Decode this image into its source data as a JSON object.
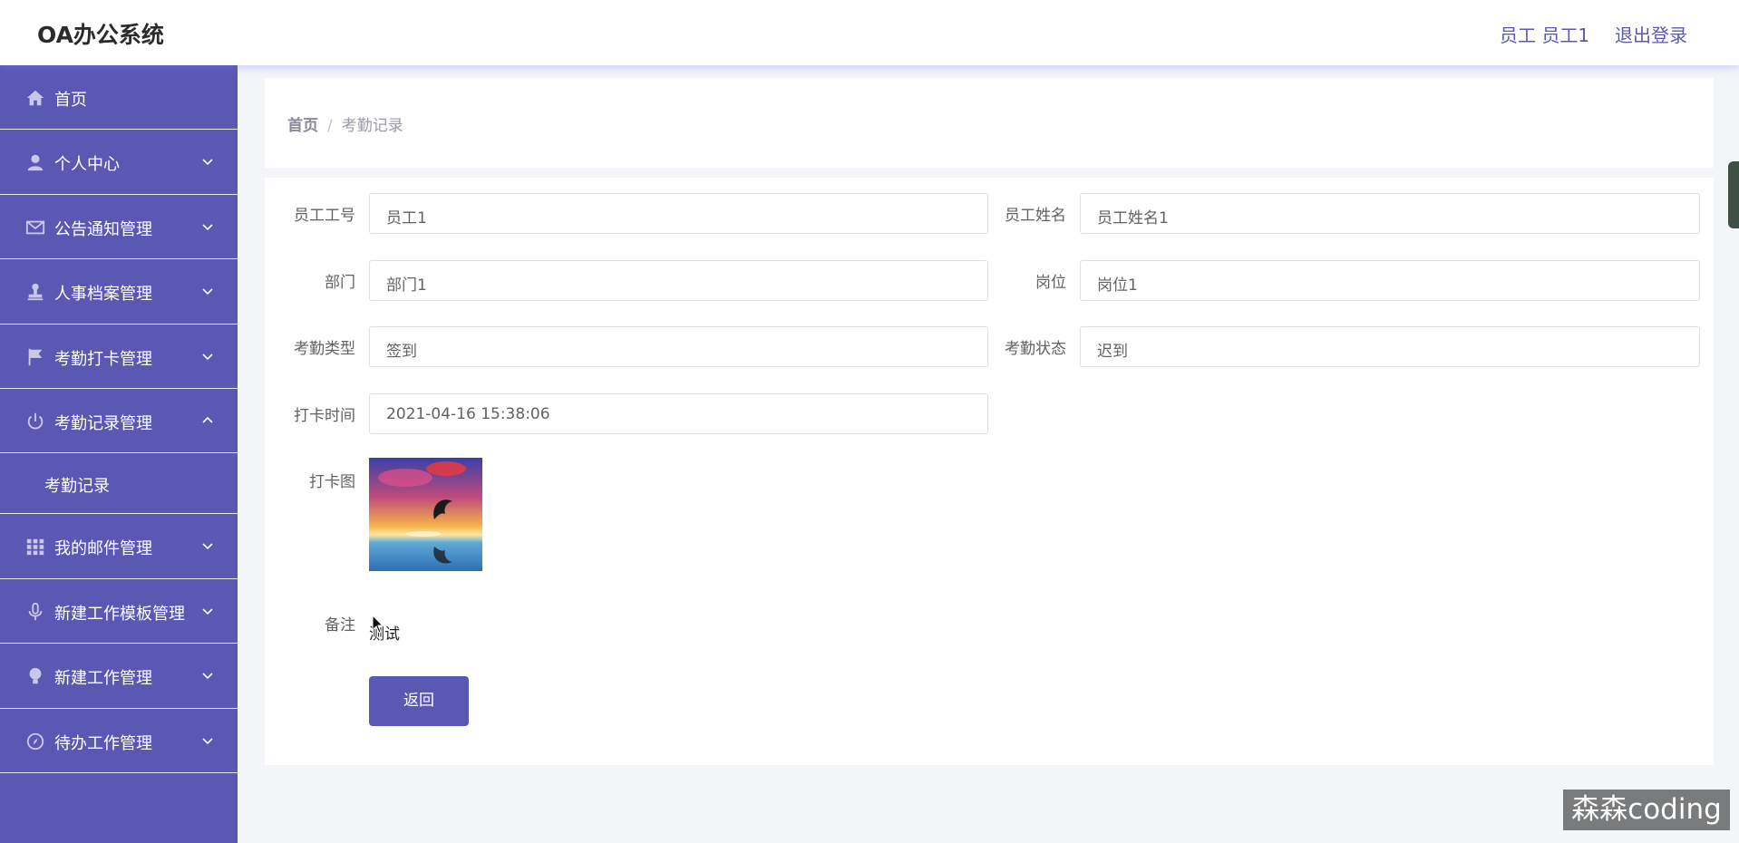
{
  "app": {
    "title": "OA办公系统"
  },
  "header": {
    "user": "员工 员工1",
    "logout": "退出登录"
  },
  "sidebar": {
    "items": [
      {
        "label": "首页",
        "icon": "home-icon",
        "has_arrow": false
      },
      {
        "label": "个人中心",
        "icon": "user-icon",
        "has_arrow": true
      },
      {
        "label": "公告通知管理",
        "icon": "mail-icon",
        "has_arrow": true
      },
      {
        "label": "人事档案管理",
        "icon": "stamp-icon",
        "has_arrow": true
      },
      {
        "label": "考勤打卡管理",
        "icon": "flag-icon",
        "has_arrow": true
      },
      {
        "label": "考勤记录管理",
        "icon": "power-icon",
        "has_arrow": true,
        "expanded": true
      },
      {
        "label": "我的邮件管理",
        "icon": "grid-icon",
        "has_arrow": true
      },
      {
        "label": "新建工作模板管理",
        "icon": "microphone-icon",
        "has_arrow": true
      },
      {
        "label": "新建工作管理",
        "icon": "lightbulb-icon",
        "has_arrow": true
      },
      {
        "label": "待办工作管理",
        "icon": "compass-icon",
        "has_arrow": true
      }
    ],
    "submenu": [
      {
        "label": "考勤记录"
      }
    ]
  },
  "breadcrumb": {
    "home": "首页",
    "separator": "/",
    "current": "考勤记录"
  },
  "form": {
    "employee_no": {
      "label": "员工工号",
      "value": "员工1"
    },
    "employee_name": {
      "label": "员工姓名",
      "value": "员工姓名1"
    },
    "department": {
      "label": "部门",
      "value": "部门1"
    },
    "position": {
      "label": "岗位",
      "value": "岗位1"
    },
    "attendance_type": {
      "label": "考勤类型",
      "value": "签到"
    },
    "attendance_status": {
      "label": "考勤状态",
      "value": "迟到"
    },
    "punch_time": {
      "label": "打卡时间",
      "value": "2021-04-16 15:38:06"
    },
    "punch_photo": {
      "label": "打卡图"
    },
    "remark": {
      "label": "备注",
      "value": "测试"
    },
    "back_button": "返回"
  },
  "watermark": "森森coding",
  "colors": {
    "accent": "#5b58b4",
    "page_bg": "#f4f5f9",
    "sidebar_divider": "#e6e6f5"
  }
}
